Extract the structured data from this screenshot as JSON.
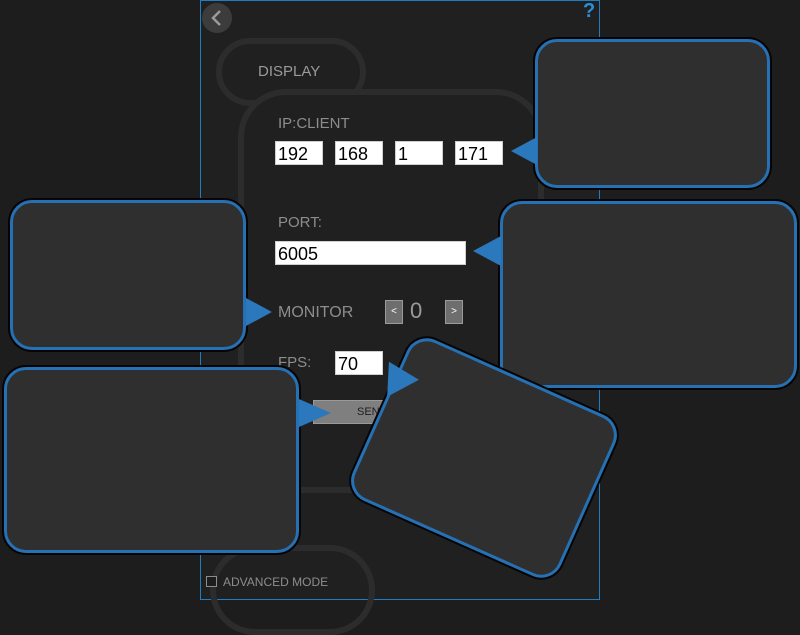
{
  "header": {
    "help_glyph": "?"
  },
  "display": {
    "label": "DISPLAY"
  },
  "ip": {
    "label": "IP:CLIENT",
    "octets": [
      "192",
      "168",
      "1",
      "171"
    ]
  },
  "port": {
    "label": "PORT:",
    "value": "6005"
  },
  "monitor": {
    "label": "MONITOR",
    "value": "0",
    "dec": "<",
    "inc": ">"
  },
  "fps": {
    "label": "FPS:",
    "value": "70"
  },
  "send": {
    "label": "SEND"
  },
  "footer": {
    "advanced_label": "ADVANCED MODE",
    "advanced_checked": false
  },
  "colors": {
    "accent": "#1f7ec2",
    "callout_border": "#2670b4",
    "callout_pointer": "#2b78bd"
  }
}
